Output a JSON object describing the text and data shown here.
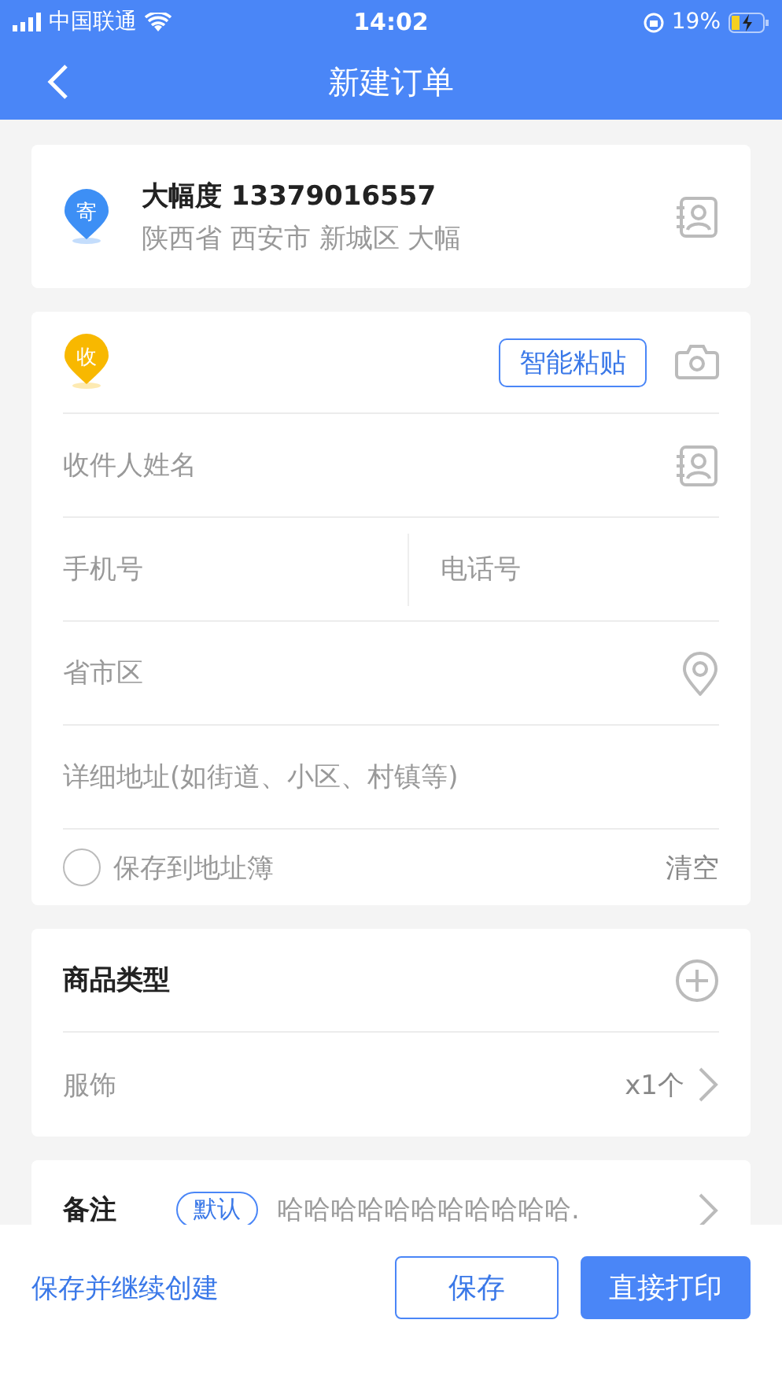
{
  "status_bar": {
    "carrier": "中国联通",
    "time": "14:02",
    "battery": "19%"
  },
  "nav": {
    "title": "新建订单"
  },
  "sender": {
    "badge": "寄",
    "name_phone": "大幅度 13379016557",
    "address": "陕西省 西安市 新城区 大幅"
  },
  "recipient": {
    "badge": "收",
    "paste_button": "智能粘贴",
    "fields": [
      {
        "kind": "contact",
        "placeholder": "收件人姓名"
      },
      {
        "kind": "split",
        "placeholder": "手机号",
        "placeholder_2": "电话号"
      },
      {
        "kind": "location",
        "placeholder": "省市区"
      },
      {
        "kind": "plain",
        "placeholder": "详细地址(如街道、小区、村镇等)"
      }
    ],
    "save_to_book": {
      "label": "保存到地址簿",
      "checked": false
    },
    "clear": "清空"
  },
  "goods": {
    "title": "商品类型",
    "items": [
      {
        "name": "服饰",
        "quantity": "x1个"
      }
    ]
  },
  "notes": {
    "title": "备注",
    "tag": "默认",
    "text": "哈哈哈哈哈哈哈哈哈哈哈."
  },
  "actions": {
    "link": "保存并继续创建",
    "buttons": [
      {
        "label": "保存",
        "kind": "outline"
      },
      {
        "label": "直接打印",
        "kind": "filled"
      }
    ]
  }
}
